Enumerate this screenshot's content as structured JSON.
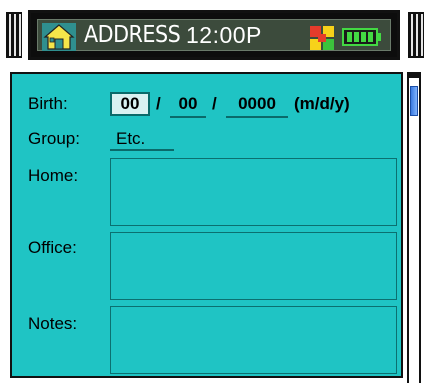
{
  "header": {
    "app_icon": "home-icon",
    "title": "ADDRESS",
    "time": "12:00P",
    "switch_icon": "app-switch-icon",
    "battery_icon": "battery-icon"
  },
  "form": {
    "birth_label": "Birth:",
    "birth_month": "00",
    "birth_day": "00",
    "birth_year": "0000",
    "date_separator": "/",
    "date_format_hint": "(m/d/y)",
    "group_label": "Group:",
    "group_value": "Etc.",
    "home_label": "Home:",
    "home_value": "",
    "office_label": "Office:",
    "office_value": "",
    "notes_label": "Notes:",
    "notes_value": ""
  },
  "colors": {
    "panel": "#1fc4c4",
    "header": "#3c4b3c",
    "scroll_thumb": "#3a7ae0"
  }
}
